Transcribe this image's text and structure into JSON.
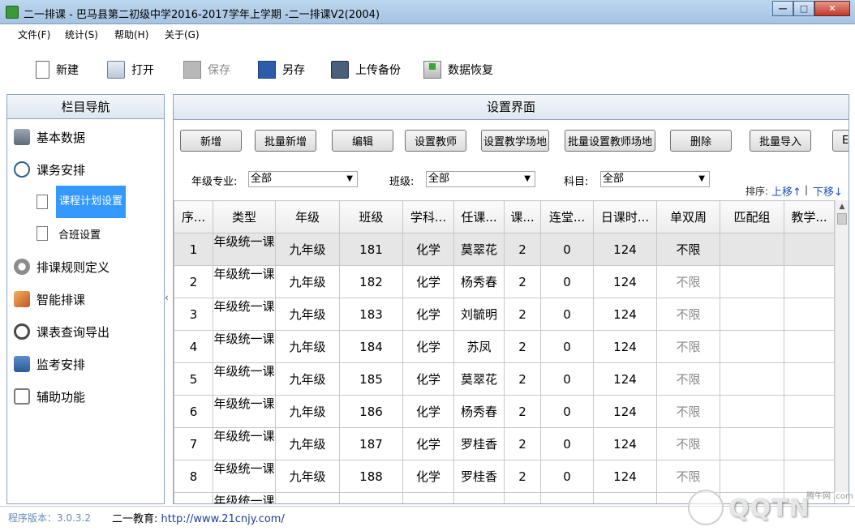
{
  "window": {
    "title": "二一排课 - 巴马县第二初级中学2016-2017学年上学期 -二一排课V2(2004)",
    "min": "—",
    "max": "□",
    "close": "✕"
  },
  "menu": [
    {
      "label": "文件(F)"
    },
    {
      "label": "统计(S)"
    },
    {
      "label": "帮助(H)"
    },
    {
      "label": "关于(G)"
    }
  ],
  "toolbar": {
    "new": "新建",
    "open": "打开",
    "save": "保存",
    "saveas": "另存",
    "upload": "上传备份",
    "restore": "数据恢复"
  },
  "sidebar": {
    "title": "栏目导航",
    "items": [
      {
        "label": "基本数据",
        "icon": "database-icon"
      },
      {
        "label": "课务安排",
        "icon": "clock-icon"
      },
      {
        "label": "排课规则定义",
        "icon": "gear-icon"
      },
      {
        "label": "智能排课",
        "icon": "pencil-icon"
      },
      {
        "label": "课表查询导出",
        "icon": "magnifier-icon"
      },
      {
        "label": "监考安排",
        "icon": "monitor-icon"
      },
      {
        "label": "辅助功能",
        "icon": "tools-icon"
      }
    ],
    "subitems": [
      {
        "label": "课程计划设置"
      },
      {
        "label": "合班设置"
      }
    ]
  },
  "main": {
    "title": "设置界面",
    "buttons": [
      "新增",
      "批量新增",
      "编辑",
      "设置教师",
      "设置教学场地",
      "批量设置教师场地",
      "删除",
      "批量导入",
      "Ex"
    ],
    "filters": {
      "grade_label": "年级专业:",
      "grade_value": "全部",
      "class_label": "班级:",
      "class_value": "全部",
      "subject_label": "科目:",
      "subject_value": "全部"
    },
    "sort": {
      "label": "排序:",
      "up": "上移↑",
      "sep": "|",
      "down": "下移↓"
    },
    "columns": [
      "序...",
      "类型",
      "年级",
      "班级",
      "学科...",
      "任课...",
      "课...",
      "连堂...",
      "日课时...",
      "单双周",
      "匹配组",
      "教学..."
    ],
    "rows": [
      {
        "no": "1",
        "type": "年级统一课",
        "grade": "九年级",
        "cls": "181",
        "subject": "化学",
        "teacher": "莫翠花",
        "lessons": "2",
        "consec": "0",
        "daily": "124",
        "week": "不限",
        "group": "",
        "place": ""
      },
      {
        "no": "2",
        "type": "年级统一课",
        "grade": "九年级",
        "cls": "182",
        "subject": "化学",
        "teacher": "杨秀春",
        "lessons": "2",
        "consec": "0",
        "daily": "124",
        "week": "不限",
        "group": "",
        "place": ""
      },
      {
        "no": "3",
        "type": "年级统一课",
        "grade": "九年级",
        "cls": "183",
        "subject": "化学",
        "teacher": "刘毓明",
        "lessons": "2",
        "consec": "0",
        "daily": "124",
        "week": "不限",
        "group": "",
        "place": ""
      },
      {
        "no": "4",
        "type": "年级统一课",
        "grade": "九年级",
        "cls": "184",
        "subject": "化学",
        "teacher": "苏凤",
        "lessons": "2",
        "consec": "0",
        "daily": "124",
        "week": "不限",
        "group": "",
        "place": ""
      },
      {
        "no": "5",
        "type": "年级统一课",
        "grade": "九年级",
        "cls": "185",
        "subject": "化学",
        "teacher": "莫翠花",
        "lessons": "2",
        "consec": "0",
        "daily": "124",
        "week": "不限",
        "group": "",
        "place": ""
      },
      {
        "no": "6",
        "type": "年级统一课",
        "grade": "九年级",
        "cls": "186",
        "subject": "化学",
        "teacher": "杨秀春",
        "lessons": "2",
        "consec": "0",
        "daily": "124",
        "week": "不限",
        "group": "",
        "place": ""
      },
      {
        "no": "7",
        "type": "年级统一课",
        "grade": "九年级",
        "cls": "187",
        "subject": "化学",
        "teacher": "罗桂香",
        "lessons": "2",
        "consec": "0",
        "daily": "124",
        "week": "不限",
        "group": "",
        "place": ""
      },
      {
        "no": "8",
        "type": "年级统一课",
        "grade": "九年级",
        "cls": "188",
        "subject": "化学",
        "teacher": "罗桂香",
        "lessons": "2",
        "consec": "0",
        "daily": "124",
        "week": "不限",
        "group": "",
        "place": ""
      },
      {
        "no": "",
        "type": "年级统一课",
        "grade": "",
        "cls": "",
        "subject": "",
        "teacher": "",
        "lessons": "",
        "consec": "",
        "daily": "",
        "week": "",
        "group": "",
        "place": ""
      }
    ]
  },
  "status": {
    "version": "程序版本：3.0.3.2",
    "org": "二一教育: ",
    "url": "http://www.21cnjy.com/"
  },
  "watermark": {
    "text": "QQTN",
    "small": "腾牛网 .com"
  }
}
